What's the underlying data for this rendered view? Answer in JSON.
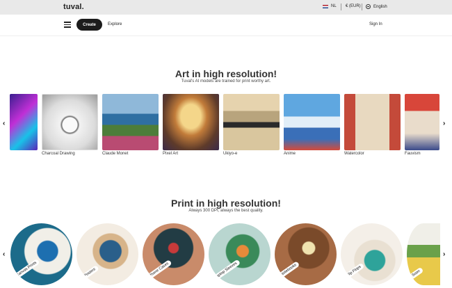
{
  "header": {
    "logo": "tuval.",
    "language_code": "NL",
    "currency": "€ (EUR)",
    "language": "English"
  },
  "nav": {
    "create_label": "Create",
    "explore_label": "Explore",
    "signin_label": "Sign In"
  },
  "art_section": {
    "title": "Art in high resolution!",
    "subtitle": "Tuval's AI models are trained for print worthy art.",
    "styles": [
      {
        "label": ""
      },
      {
        "label": "Charcoal Drawing"
      },
      {
        "label": "Claude Monet"
      },
      {
        "label": "Pixel Art"
      },
      {
        "label": "Ukiyo-e"
      },
      {
        "label": "Anime"
      },
      {
        "label": "Watercolor"
      },
      {
        "label": "Fauvism"
      }
    ]
  },
  "print_section": {
    "title": "Print in high resolution!",
    "subtitle": "Always 300 DPI, always the best quality.",
    "products": [
      {
        "label": "Canvas Prints"
      },
      {
        "label": "Posters"
      },
      {
        "label": "Phone Cases"
      },
      {
        "label": "Laptop Sleeves"
      },
      {
        "label": "Notebooks"
      },
      {
        "label": "Flip Flops"
      },
      {
        "label": "Soon"
      }
    ]
  },
  "icons": {
    "prev": "chevron-left-icon",
    "next": "chevron-right-icon",
    "globe": "globe-icon",
    "flag": "nl-flag-icon",
    "menu": "hamburger-icon"
  }
}
